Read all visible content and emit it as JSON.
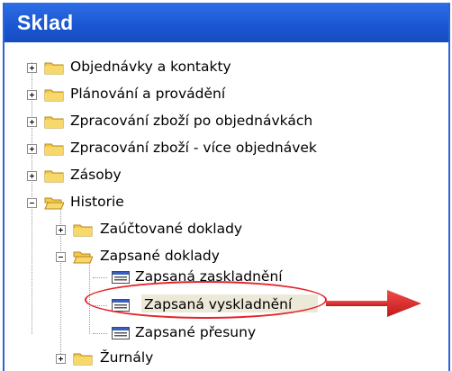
{
  "window": {
    "title": "Sklad"
  },
  "tree": {
    "items": [
      {
        "label": "Objednávky a kontakty",
        "expanded": false,
        "type": "folder"
      },
      {
        "label": "Plánování a provádění",
        "expanded": false,
        "type": "folder"
      },
      {
        "label": "Zpracování zboží po objednávkách",
        "expanded": false,
        "type": "folder"
      },
      {
        "label": "Zpracování zboží - více objednávek",
        "expanded": false,
        "type": "folder"
      },
      {
        "label": "Zásoby",
        "expanded": false,
        "type": "folder"
      },
      {
        "label": "Historie",
        "expanded": true,
        "type": "folder"
      },
      {
        "label": "Zaúčtované doklady",
        "expanded": false,
        "type": "folder"
      },
      {
        "label": "Zapsané doklady",
        "expanded": true,
        "type": "folder"
      },
      {
        "label": "Zapsaná zaskladnění",
        "type": "document"
      },
      {
        "label": "Zapsaná vyskladnění",
        "type": "document",
        "selected": true
      },
      {
        "label": "Zapsané přesuny",
        "type": "document"
      },
      {
        "label": "Žurnály",
        "expanded": false,
        "type": "folder"
      }
    ]
  },
  "annotation": {
    "highlight_color": "#e4252a",
    "arrow_color": "#e4252a"
  },
  "colors": {
    "title_bar": "#1b57d3",
    "folder": "#f2c94c",
    "selection": "#ece9d8"
  }
}
